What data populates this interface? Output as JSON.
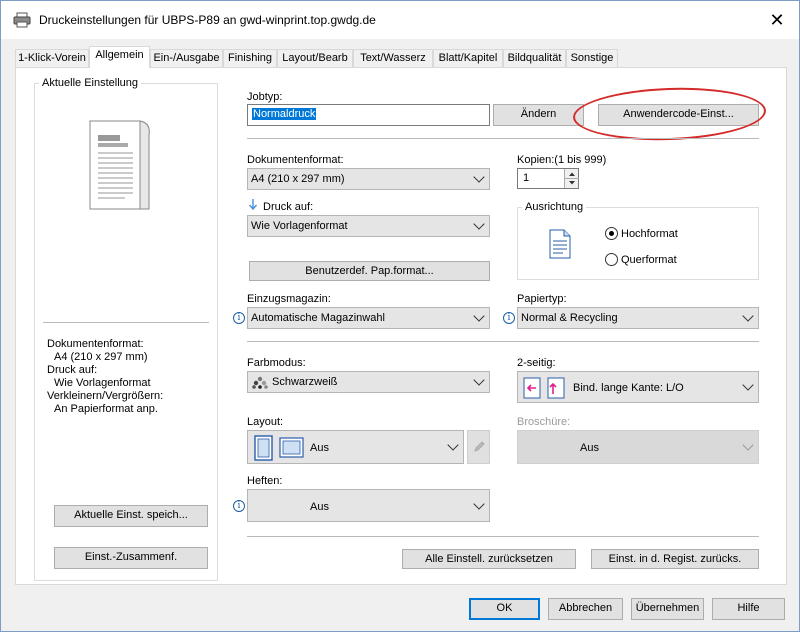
{
  "window": {
    "title": "Druckeinstellungen für UBPS-P89 an gwd-winprint.top.gwdg.de",
    "close_glyph": "✕"
  },
  "tabs": [
    {
      "label": "1-Klick-Vorein"
    },
    {
      "label": "Allgemein"
    },
    {
      "label": "Ein-/Ausgabe"
    },
    {
      "label": "Finishing"
    },
    {
      "label": "Layout/Bearb"
    },
    {
      "label": "Text/Wasserz"
    },
    {
      "label": "Blatt/Kapitel"
    },
    {
      "label": "Bildqualität"
    },
    {
      "label": "Sonstige"
    }
  ],
  "left_panel": {
    "group_title": "Aktuelle Einstellung",
    "summary": {
      "format_label": "Dokumentenformat:",
      "format_value": "A4 (210 x 297 mm)",
      "print_on_label": "Druck auf:",
      "print_on_value": "Wie Vorlagenformat",
      "scale_label": "Verkleinern/Vergrößern:",
      "scale_value": "An Papierformat anp."
    },
    "save_button": "Aktuelle Einst. speich...",
    "summary_button": "Einst.-Zusammenf."
  },
  "jobtype": {
    "label": "Jobtyp:",
    "value": "Normaldruck",
    "change_button": "Ändern",
    "usercode_button": "Anwendercode-Einst..."
  },
  "doc_format": {
    "label": "Dokumentenformat:",
    "value": "A4 (210 x 297 mm)"
  },
  "copies": {
    "label": "Kopien:(1 bis 999)",
    "value": "1"
  },
  "print_on": {
    "label": "Druck auf:",
    "value": "Wie Vorlagenformat"
  },
  "orientation": {
    "label": "Ausrichtung",
    "portrait": "Hochformat",
    "landscape": "Querformat",
    "selected": "Hochformat"
  },
  "custom_paper_button": "Benutzerdef. Pap.format...",
  "input_tray": {
    "label": "Einzugsmagazin:",
    "value": "Automatische Magazinwahl"
  },
  "paper_type": {
    "label": "Papiertyp:",
    "value": "Normal & Recycling"
  },
  "color_mode": {
    "label": "Farbmodus:",
    "value": "Schwarzweiß"
  },
  "duplex": {
    "label": "2-seitig:",
    "value": "Bind. lange Kante: L/O"
  },
  "layout": {
    "label": "Layout:",
    "value": "Aus"
  },
  "booklet": {
    "label": "Broschüre:",
    "value": "Aus"
  },
  "staple": {
    "label": "Heften:",
    "value": "Aus"
  },
  "reset_all_button": "Alle Einstell. zurücksetzen",
  "registry_reset_button": "Einst. in d. Regist. zurücks.",
  "footer": {
    "ok": "OK",
    "cancel": "Abbrechen",
    "apply": "Übernehmen",
    "help": "Hilfe"
  },
  "colors": {
    "annotation_circle": "#d42a2a",
    "selection": "#0078d7"
  }
}
